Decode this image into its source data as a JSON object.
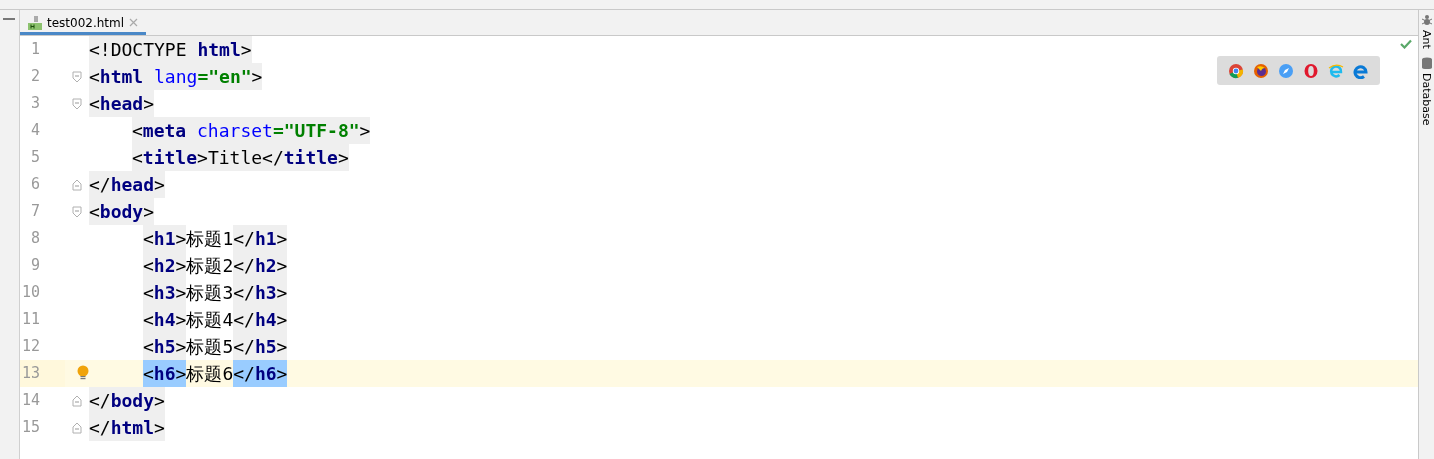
{
  "tab": {
    "label": "test002.html",
    "selected": true
  },
  "lines": [
    {
      "number": "1",
      "kind": "top",
      "fold_start": false,
      "fold_end": false,
      "current": false,
      "bulb": false,
      "segments": [
        {
          "kind": "tag",
          "matched": false,
          "tokens": [
            {
              "kind": "punct",
              "text": "<!DOCTYPE "
            },
            {
              "kind": "name",
              "text": "html"
            },
            {
              "kind": "punct",
              "text": ">"
            }
          ]
        }
      ]
    },
    {
      "number": "2",
      "kind": "top",
      "fold_start": true,
      "fold_end": false,
      "current": false,
      "bulb": false,
      "segments": [
        {
          "kind": "tag",
          "matched": false,
          "tokens": [
            {
              "kind": "punct",
              "text": "<"
            },
            {
              "kind": "name",
              "text": "html "
            },
            {
              "kind": "attr",
              "text": "lang"
            },
            {
              "kind": "value",
              "text": "=\"en\""
            },
            {
              "kind": "punct",
              "text": ">"
            }
          ]
        }
      ]
    },
    {
      "number": "3",
      "kind": "top",
      "fold_start": true,
      "fold_end": false,
      "current": false,
      "bulb": false,
      "segments": [
        {
          "kind": "tag",
          "matched": false,
          "tokens": [
            {
              "kind": "punct",
              "text": "<"
            },
            {
              "kind": "name",
              "text": "head"
            },
            {
              "kind": "punct",
              "text": ">"
            }
          ]
        }
      ]
    },
    {
      "number": "4",
      "kind": "head_child",
      "fold_start": false,
      "fold_end": false,
      "current": false,
      "bulb": false,
      "segments": [
        {
          "kind": "tag",
          "matched": false,
          "tokens": [
            {
              "kind": "punct",
              "text": "<"
            },
            {
              "kind": "name",
              "text": "meta "
            },
            {
              "kind": "attr",
              "text": "charset"
            },
            {
              "kind": "value",
              "text": "=\"UTF-8\""
            },
            {
              "kind": "punct",
              "text": ">"
            }
          ]
        }
      ]
    },
    {
      "number": "5",
      "kind": "head_child",
      "fold_start": false,
      "fold_end": false,
      "current": false,
      "bulb": false,
      "segments": [
        {
          "kind": "tag",
          "matched": false,
          "tokens": [
            {
              "kind": "punct",
              "text": "<"
            },
            {
              "kind": "name",
              "text": "title"
            },
            {
              "kind": "punct",
              "text": ">"
            }
          ]
        },
        {
          "kind": "tagtext",
          "text": "Title"
        },
        {
          "kind": "tag",
          "matched": false,
          "tokens": [
            {
              "kind": "punct",
              "text": "</"
            },
            {
              "kind": "name",
              "text": "title"
            },
            {
              "kind": "punct",
              "text": ">"
            }
          ]
        }
      ]
    },
    {
      "number": "6",
      "kind": "top",
      "fold_start": false,
      "fold_end": true,
      "current": false,
      "bulb": false,
      "segments": [
        {
          "kind": "tag",
          "matched": false,
          "tokens": [
            {
              "kind": "punct",
              "text": "</"
            },
            {
              "kind": "name",
              "text": "head"
            },
            {
              "kind": "punct",
              "text": ">"
            }
          ]
        }
      ]
    },
    {
      "number": "7",
      "kind": "top",
      "fold_start": true,
      "fold_end": false,
      "current": false,
      "bulb": false,
      "segments": [
        {
          "kind": "tag",
          "matched": false,
          "tokens": [
            {
              "kind": "punct",
              "text": "<"
            },
            {
              "kind": "name",
              "text": "body"
            },
            {
              "kind": "punct",
              "text": ">"
            }
          ]
        }
      ]
    },
    {
      "number": "8",
      "kind": "body_child",
      "fold_start": false,
      "fold_end": false,
      "current": false,
      "bulb": false,
      "segments": [
        {
          "kind": "tag",
          "matched": false,
          "tokens": [
            {
              "kind": "punct",
              "text": "<"
            },
            {
              "kind": "name",
              "text": "h1"
            },
            {
              "kind": "punct",
              "text": ">"
            }
          ]
        },
        {
          "kind": "text",
          "text": "标题1"
        },
        {
          "kind": "tag",
          "matched": false,
          "tokens": [
            {
              "kind": "punct",
              "text": "</"
            },
            {
              "kind": "name",
              "text": "h1"
            },
            {
              "kind": "punct",
              "text": ">"
            }
          ]
        }
      ]
    },
    {
      "number": "9",
      "kind": "body_child",
      "fold_start": false,
      "fold_end": false,
      "current": false,
      "bulb": false,
      "segments": [
        {
          "kind": "tag",
          "matched": false,
          "tokens": [
            {
              "kind": "punct",
              "text": "<"
            },
            {
              "kind": "name",
              "text": "h2"
            },
            {
              "kind": "punct",
              "text": ">"
            }
          ]
        },
        {
          "kind": "text",
          "text": "标题2"
        },
        {
          "kind": "tag",
          "matched": false,
          "tokens": [
            {
              "kind": "punct",
              "text": "</"
            },
            {
              "kind": "name",
              "text": "h2"
            },
            {
              "kind": "punct",
              "text": ">"
            }
          ]
        }
      ]
    },
    {
      "number": "10",
      "kind": "body_child",
      "fold_start": false,
      "fold_end": false,
      "current": false,
      "bulb": false,
      "segments": [
        {
          "kind": "tag",
          "matched": false,
          "tokens": [
            {
              "kind": "punct",
              "text": "<"
            },
            {
              "kind": "name",
              "text": "h3"
            },
            {
              "kind": "punct",
              "text": ">"
            }
          ]
        },
        {
          "kind": "text",
          "text": "标题3"
        },
        {
          "kind": "tag",
          "matched": false,
          "tokens": [
            {
              "kind": "punct",
              "text": "</"
            },
            {
              "kind": "name",
              "text": "h3"
            },
            {
              "kind": "punct",
              "text": ">"
            }
          ]
        }
      ]
    },
    {
      "number": "11",
      "kind": "body_child",
      "fold_start": false,
      "fold_end": false,
      "current": false,
      "bulb": false,
      "segments": [
        {
          "kind": "tag",
          "matched": false,
          "tokens": [
            {
              "kind": "punct",
              "text": "<"
            },
            {
              "kind": "name",
              "text": "h4"
            },
            {
              "kind": "punct",
              "text": ">"
            }
          ]
        },
        {
          "kind": "text",
          "text": "标题4"
        },
        {
          "kind": "tag",
          "matched": false,
          "tokens": [
            {
              "kind": "punct",
              "text": "</"
            },
            {
              "kind": "name",
              "text": "h4"
            },
            {
              "kind": "punct",
              "text": ">"
            }
          ]
        }
      ]
    },
    {
      "number": "12",
      "kind": "body_child",
      "fold_start": false,
      "fold_end": false,
      "current": false,
      "bulb": false,
      "segments": [
        {
          "kind": "tag",
          "matched": false,
          "tokens": [
            {
              "kind": "punct",
              "text": "<"
            },
            {
              "kind": "name",
              "text": "h5"
            },
            {
              "kind": "punct",
              "text": ">"
            }
          ]
        },
        {
          "kind": "text",
          "text": "标题5"
        },
        {
          "kind": "tag",
          "matched": false,
          "tokens": [
            {
              "kind": "punct",
              "text": "</"
            },
            {
              "kind": "name",
              "text": "h5"
            },
            {
              "kind": "punct",
              "text": ">"
            }
          ]
        }
      ]
    },
    {
      "number": "13",
      "kind": "body_child",
      "fold_start": false,
      "fold_end": false,
      "current": true,
      "bulb": true,
      "segments": [
        {
          "kind": "tag",
          "matched": true,
          "tokens": [
            {
              "kind": "punct",
              "text": "<"
            },
            {
              "kind": "name",
              "text": "h6"
            },
            {
              "kind": "punct",
              "text": ">"
            }
          ]
        },
        {
          "kind": "text",
          "text": "标题6"
        },
        {
          "kind": "caret"
        },
        {
          "kind": "tag",
          "matched": true,
          "tokens": [
            {
              "kind": "punct",
              "text": "</"
            },
            {
              "kind": "name",
              "text": "h6"
            },
            {
              "kind": "punct",
              "text": ">"
            }
          ]
        }
      ]
    },
    {
      "number": "14",
      "kind": "top",
      "fold_start": false,
      "fold_end": true,
      "current": false,
      "bulb": false,
      "segments": [
        {
          "kind": "tag",
          "matched": false,
          "tokens": [
            {
              "kind": "punct",
              "text": "</"
            },
            {
              "kind": "name",
              "text": "body"
            },
            {
              "kind": "punct",
              "text": ">"
            }
          ]
        }
      ]
    },
    {
      "number": "15",
      "kind": "top",
      "fold_start": false,
      "fold_end": true,
      "current": false,
      "bulb": false,
      "segments": [
        {
          "kind": "tag",
          "matched": false,
          "tokens": [
            {
              "kind": "punct",
              "text": "</"
            },
            {
              "kind": "name",
              "text": "html"
            },
            {
              "kind": "punct",
              "text": ">"
            }
          ]
        }
      ]
    }
  ],
  "side_tools": [
    {
      "label": "Ant"
    },
    {
      "label": "Database"
    }
  ]
}
